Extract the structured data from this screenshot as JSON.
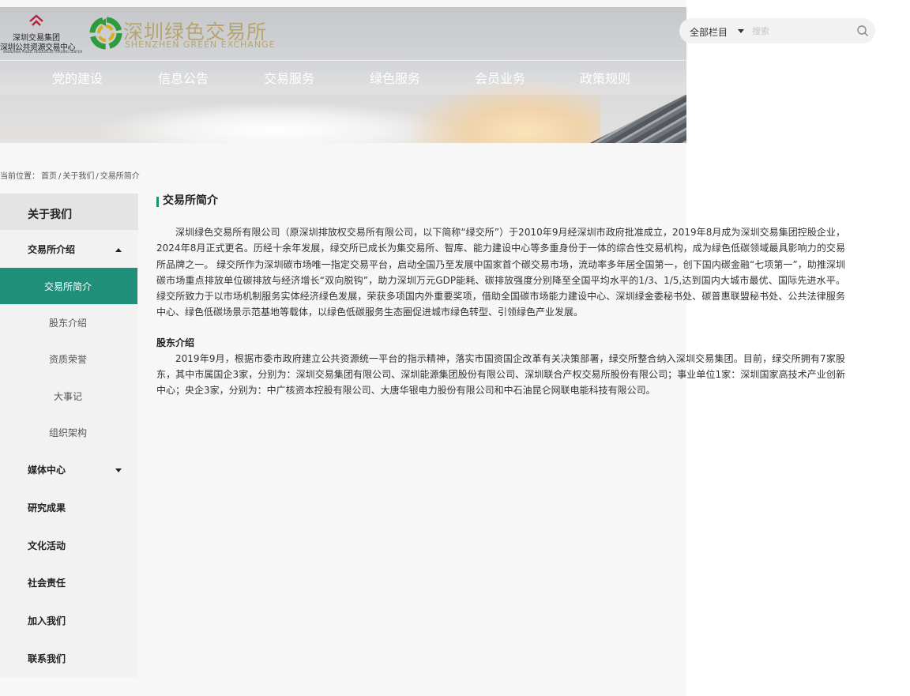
{
  "header": {
    "group_logo": {
      "line1": "深圳交易集团",
      "line2": "深圳公共资源交易中心",
      "line3": "SHENZHEN PUBLIC RESOURCES TRADING CENTER"
    },
    "brand_logo": {
      "cn": "深圳绿色交易所",
      "en": "SHENZHEN GREEN EXCHANGE"
    },
    "nav": [
      {
        "label": "党的建设"
      },
      {
        "label": "信息公告"
      },
      {
        "label": "交易服务"
      },
      {
        "label": "绿色服务"
      },
      {
        "label": "会员业务"
      },
      {
        "label": "政策规则"
      }
    ]
  },
  "search": {
    "category": "全部栏目",
    "placeholder": "搜索",
    "value": ""
  },
  "breadcrumb": {
    "prefix": "当前位置：",
    "items": [
      "首页",
      "/",
      "关于我们",
      "/",
      "交易所简介"
    ]
  },
  "sidebar": {
    "heading": "关于我们",
    "items": [
      {
        "label": "交易所介绍",
        "expanded": true
      },
      {
        "label": "交易所简介",
        "active": true
      },
      {
        "label": "股东介绍"
      },
      {
        "label": "资质荣誉"
      },
      {
        "label": "大事记"
      },
      {
        "label": "组织架构"
      },
      {
        "label": "媒体中心",
        "expanded": false
      },
      {
        "label": "研究成果"
      },
      {
        "label": "文化活动"
      },
      {
        "label": "社会责任"
      },
      {
        "label": "加入我们"
      },
      {
        "label": "联系我们"
      }
    ]
  },
  "main": {
    "title": "交易所简介",
    "intro": "深圳绿色交易所有限公司（原深圳排放权交易所有限公司，以下简称“绿交所”）于2010年9月经深圳市政府批准成立，2019年8月成为深圳交易集团控股企业，2024年8月正式更名。历经十余年发展，绿交所已成长为集交易所、智库、能力建设中心等多重身份于一体的综合性交易机构，成为绿色低碳领域最具影响力的交易所品牌之一。 绿交所作为深圳碳市场唯一指定交易平台，启动全国乃至发展中国家首个碳交易市场，流动率多年居全国第一，创下国内碳金融“七项第一”，助推深圳碳市场重点排放单位碳排放与经济增长“双向脱钩”，助力深圳万元GDP能耗、碳排放强度分别降至全国平均水平的1/3、1/5,达到国内大城市最优、国际先进水平。 绿交所致力于以市场机制服务实体经济绿色发展，荣获多项国内外重要奖项，借助全国碳市场能力建设中心、深圳绿金委秘书处、碳普惠联盟秘书处、公共法律服务中心、绿色低碳场景示范基地等载体，以绿色低碳服务生态圈促进城市绿色转型、引领绿色产业发展。",
    "shareholders_heading": "股东介绍",
    "shareholders_text": "2019年9月，根据市委市政府建立公共资源统一平台的指示精神，落实市国资国企改革有关决策部署，绿交所整合纳入深圳交易集团。目前，绿交所拥有7家股东，其中市属国企3家，分别为：深圳交易集团有限公司、深圳能源集团股份有限公司、深圳联合产权交易所股份有限公司；事业单位1家：深圳国家高技术产业创新中心；央企3家，分别为：中广核资本控股有限公司、大唐华银电力股份有限公司和中石油昆仑网联电能科技有限公司。"
  },
  "colors": {
    "accent": "#1f8f7a",
    "logo_gold": "#b8a46e",
    "sidebar_bg": "#f2f2f2",
    "sidebar_head_bg": "#e4e4e4"
  }
}
